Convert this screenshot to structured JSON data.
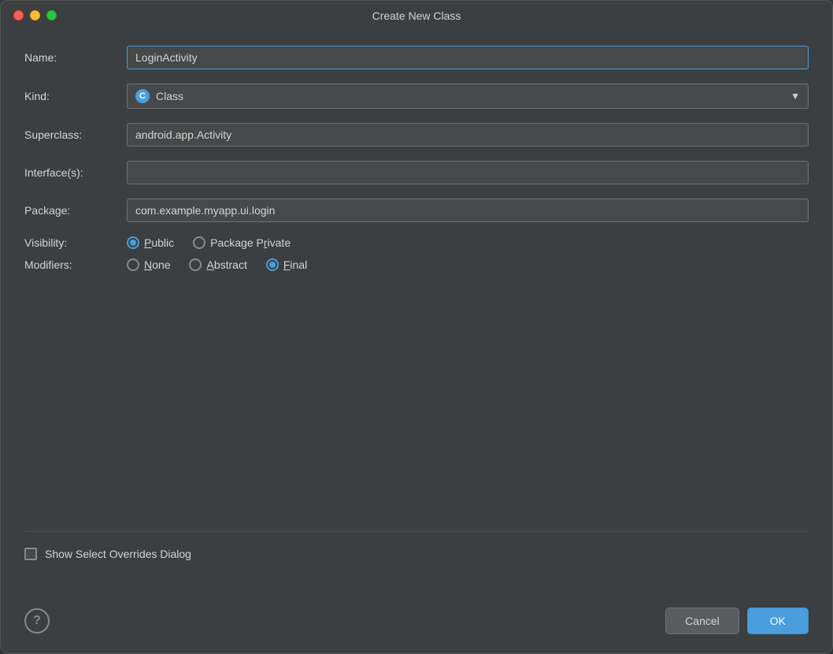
{
  "window": {
    "title": "Create New Class",
    "traffic_lights": {
      "close": "close",
      "minimize": "minimize",
      "maximize": "maximize"
    }
  },
  "form": {
    "name_label": "Name:",
    "name_value": "LoginActivity",
    "kind_label": "Kind:",
    "kind_value": "Class",
    "kind_icon": "C",
    "superclass_label": "Superclass:",
    "superclass_value": "android.app.Activity",
    "interfaces_label": "Interface(s):",
    "interfaces_value": "",
    "package_label": "Package:",
    "package_value": "com.example.myapp.ui.login",
    "visibility_label": "Visibility:",
    "modifiers_label": "Modifiers:",
    "visibility_options": [
      {
        "label": "Public",
        "underline": "u",
        "selected": true
      },
      {
        "label": "Package Private",
        "underline": "r",
        "selected": false
      }
    ],
    "modifiers_options": [
      {
        "label": "None",
        "underline": "N",
        "selected": false
      },
      {
        "label": "Abstract",
        "underline": "A",
        "selected": false
      },
      {
        "label": "Final",
        "underline": "F",
        "selected": true
      }
    ]
  },
  "checkbox": {
    "label": "Show Select Overrides Dialog",
    "checked": false
  },
  "footer": {
    "help_label": "?",
    "cancel_label": "Cancel",
    "ok_label": "OK"
  }
}
